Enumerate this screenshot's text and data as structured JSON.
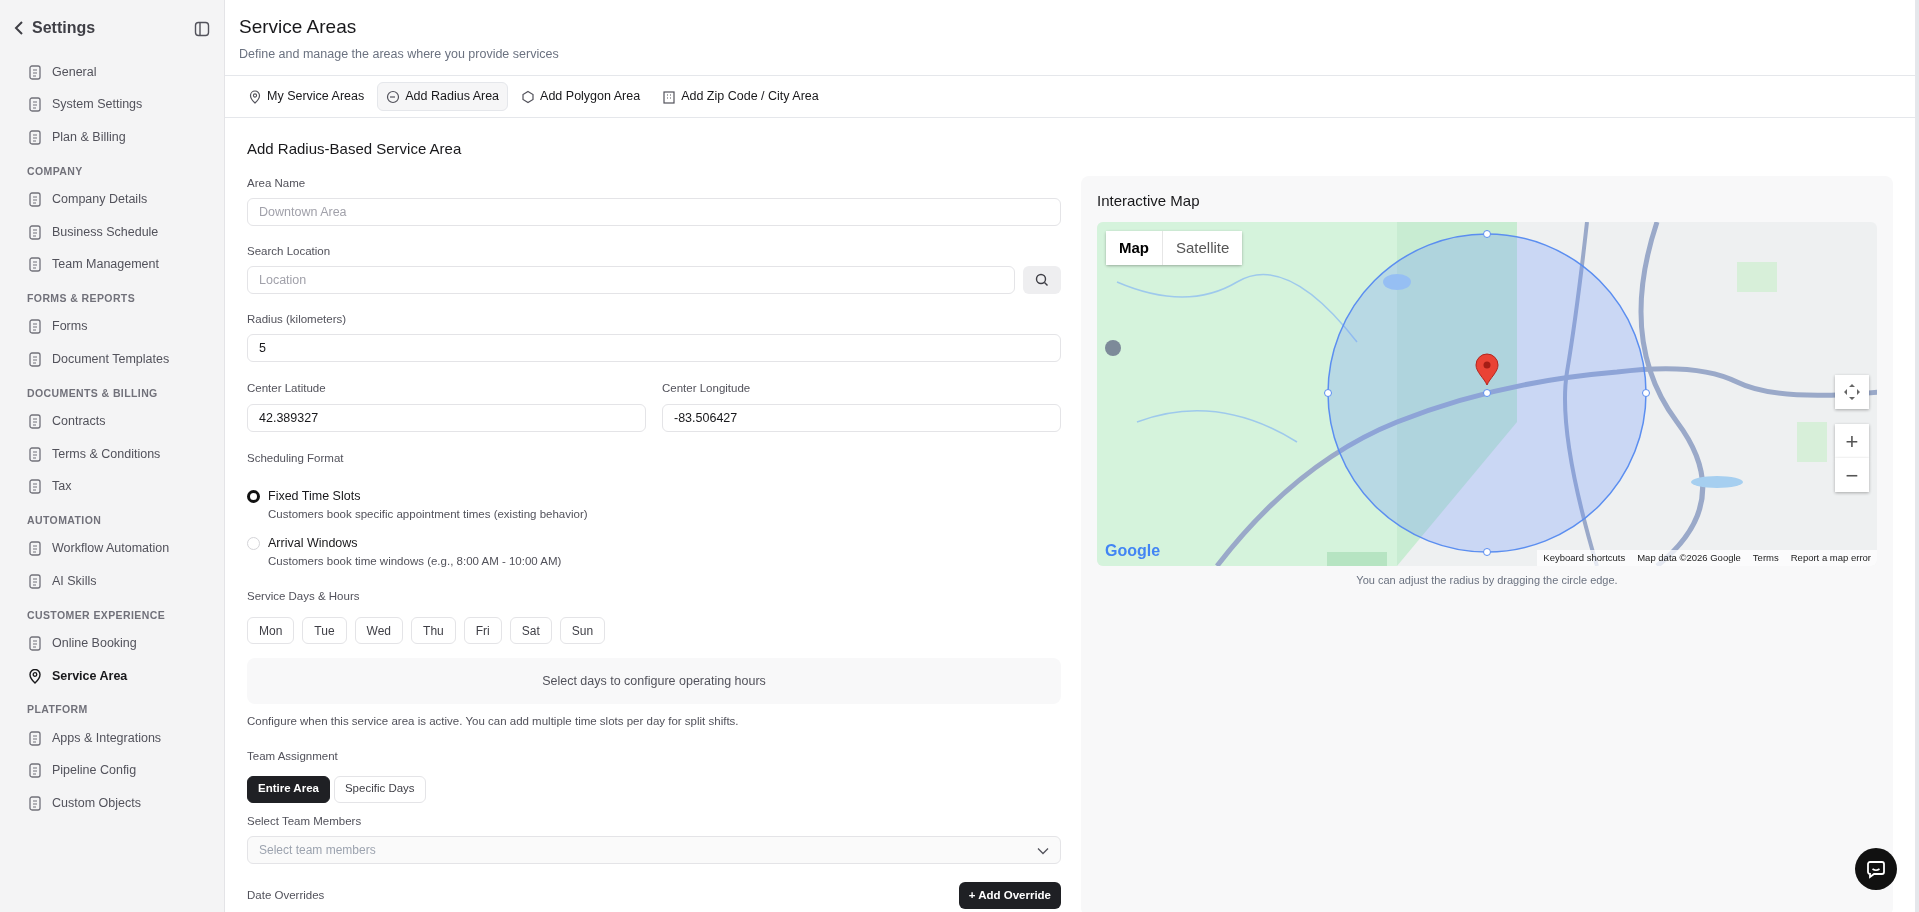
{
  "sidebar": {
    "title": "Settings",
    "sections": [
      {
        "items": [
          {
            "label": "General",
            "selected": false
          },
          {
            "label": "System Settings",
            "selected": false
          },
          {
            "label": "Plan & Billing",
            "selected": false
          }
        ]
      },
      {
        "heading": "COMPANY",
        "items": [
          {
            "label": "Company Details",
            "selected": false
          },
          {
            "label": "Business Schedule",
            "selected": false
          },
          {
            "label": "Team Management",
            "selected": false
          }
        ]
      },
      {
        "heading": "FORMS & REPORTS",
        "items": [
          {
            "label": "Forms",
            "selected": false
          },
          {
            "label": "Document Templates",
            "selected": false
          }
        ]
      },
      {
        "heading": "DOCUMENTS & BILLING",
        "items": [
          {
            "label": "Contracts",
            "selected": false
          },
          {
            "label": "Terms & Conditions",
            "selected": false
          },
          {
            "label": "Tax",
            "selected": false
          }
        ]
      },
      {
        "heading": "AUTOMATION",
        "items": [
          {
            "label": "Workflow Automation",
            "selected": false
          },
          {
            "label": "AI Skills",
            "selected": false
          }
        ]
      },
      {
        "heading": "CUSTOMER EXPERIENCE",
        "items": [
          {
            "label": "Online Booking",
            "selected": false
          },
          {
            "label": "Service Area",
            "selected": true
          }
        ]
      },
      {
        "heading": "PLATFORM",
        "items": [
          {
            "label": "Apps & Integrations",
            "selected": false
          },
          {
            "label": "Pipeline Config",
            "selected": false
          },
          {
            "label": "Custom Objects",
            "selected": false
          }
        ]
      }
    ]
  },
  "header": {
    "title": "Service Areas",
    "subtitle": "Define and manage the areas where you provide services"
  },
  "tabs": [
    {
      "label": "My Service Areas",
      "selected": false
    },
    {
      "label": "Add Radius Area",
      "selected": true
    },
    {
      "label": "Add Polygon Area",
      "selected": false
    },
    {
      "label": "Add Zip Code / City Area",
      "selected": false
    }
  ],
  "form": {
    "title": "Add Radius-Based Service Area",
    "area_name": {
      "label": "Area Name",
      "placeholder": "Downtown Area"
    },
    "search_location": {
      "label": "Search Location",
      "placeholder": "Location"
    },
    "radius": {
      "label": "Radius (kilometers)",
      "value": "5"
    },
    "latitude": {
      "label": "Center Latitude",
      "value": "42.389327"
    },
    "longitude": {
      "label": "Center Longitude",
      "value": "-83.506427"
    },
    "scheduling": {
      "label": "Scheduling Format",
      "options": [
        {
          "title": "Fixed Time Slots",
          "description": "Customers book specific appointment times (existing behavior)",
          "selected": true
        },
        {
          "title": "Arrival Windows",
          "description": "Customers book time windows (e.g., 8:00 AM - 10:00 AM)",
          "selected": false
        }
      ]
    },
    "service_days": {
      "label": "Service Days & Hours",
      "days": [
        {
          "label": "Mon",
          "selected": false
        },
        {
          "label": "Tue",
          "selected": false
        },
        {
          "label": "Wed",
          "selected": false
        },
        {
          "label": "Thu",
          "selected": false
        },
        {
          "label": "Fri",
          "selected": false
        },
        {
          "label": "Sat",
          "selected": false
        },
        {
          "label": "Sun",
          "selected": false
        }
      ],
      "empty_message": "Select days to configure operating hours",
      "help": "Configure when this service area is active. You can add multiple time slots per day for split shifts."
    },
    "team_assignment": {
      "label": "Team Assignment",
      "options": [
        {
          "label": "Entire Area",
          "selected": true
        },
        {
          "label": "Specific Days",
          "selected": false
        }
      ]
    },
    "team_members": {
      "label": "Select Team Members",
      "placeholder": "Select team members"
    },
    "date_overrides": {
      "label": "Date Overrides",
      "button": "+ Add Override"
    }
  },
  "map": {
    "title": "Interactive Map",
    "kind": "picture",
    "map_types": [
      {
        "label": "Map",
        "selected": true
      },
      {
        "label": "Satellite",
        "selected": false
      }
    ],
    "zoom_in": "+",
    "zoom_out": "−",
    "logo": "Google",
    "attribution": [
      "Keyboard shortcuts",
      "Map data ©2026 Google",
      "Terms",
      "Report a map error"
    ],
    "caption": "You can adjust the radius by dragging the circle edge."
  }
}
